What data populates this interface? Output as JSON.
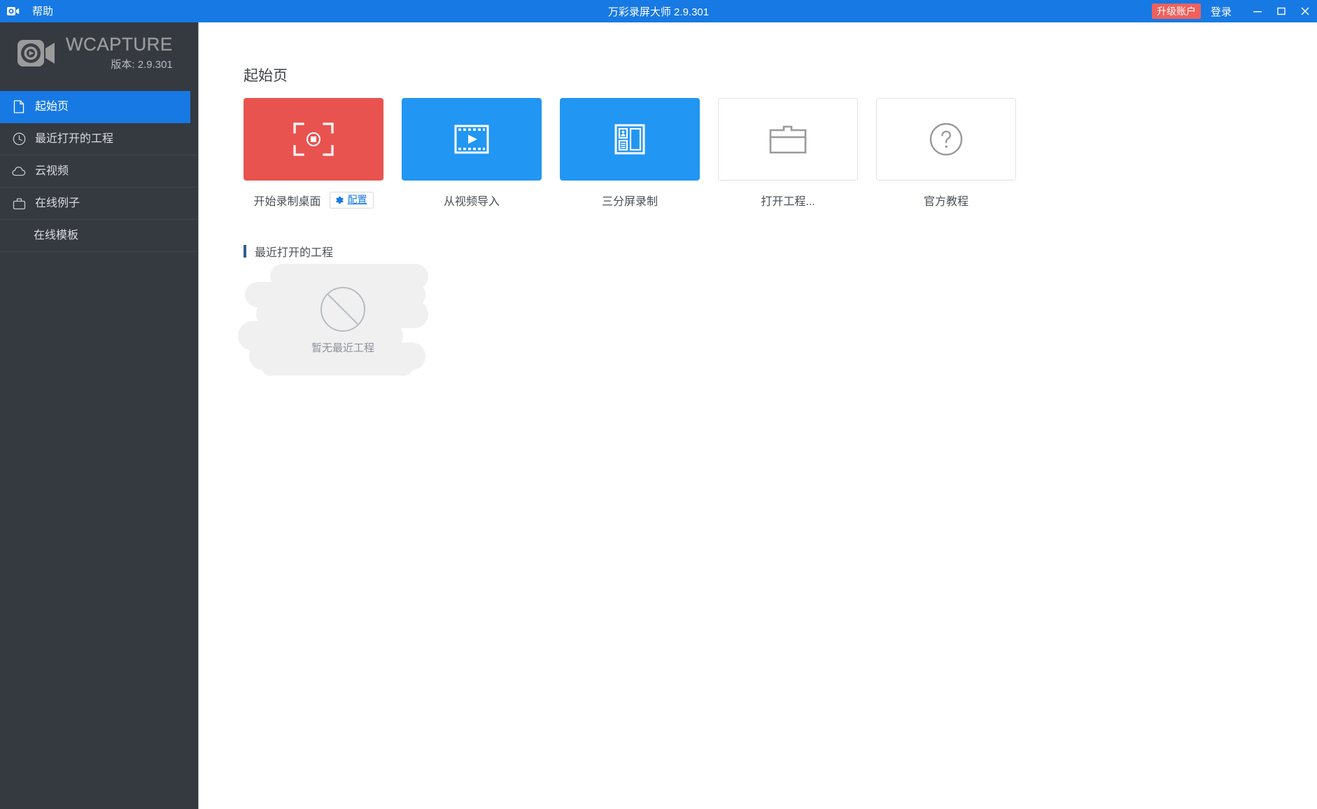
{
  "titlebar": {
    "app_icon": "video-camera-icon",
    "menu_help": "帮助",
    "window_title": "万彩录屏大师 2.9.301",
    "upgrade_label": "升级账户",
    "login_label": "登录",
    "minimize_icon": "minimize-icon",
    "maximize_icon": "maximize-icon",
    "close_icon": "close-icon",
    "bg_color": "#1779e3",
    "upgrade_color": "#f0605c"
  },
  "sidebar": {
    "brand_name": "WCAPTURE",
    "brand_version": "版本: 2.9.301",
    "brand_icon": "video-camera-logo-icon",
    "bg_color": "#353a41",
    "active_color": "#1779e3",
    "items": [
      {
        "label": "起始页",
        "icon": "document-icon",
        "active": true,
        "sub": false
      },
      {
        "label": "最近打开的工程",
        "icon": "clock-icon",
        "active": false,
        "sub": false
      },
      {
        "label": "云视频",
        "icon": "cloud-icon",
        "active": false,
        "sub": false
      },
      {
        "label": "在线例子",
        "icon": "briefcase-icon",
        "active": false,
        "sub": false
      },
      {
        "label": "在线模板",
        "icon": "",
        "active": false,
        "sub": true
      }
    ]
  },
  "main": {
    "page_title": "起始页",
    "cards": [
      {
        "label": "开始录制桌面",
        "icon": "record-target-icon",
        "style": "red",
        "has_config": true
      },
      {
        "label": "从视频导入",
        "icon": "film-play-icon",
        "style": "blue",
        "has_config": false
      },
      {
        "label": "三分屏录制",
        "icon": "split-screen-icon",
        "style": "blue",
        "has_config": false
      },
      {
        "label": "打开工程...",
        "icon": "folder-icon",
        "style": "plain",
        "has_config": false
      },
      {
        "label": "官方教程",
        "icon": "question-circle-icon",
        "style": "plain",
        "has_config": false
      }
    ],
    "config_button": {
      "label": "配置",
      "icon": "gear-icon",
      "color": "#1779e3"
    },
    "recent_section": {
      "title": "最近打开的工程",
      "accent_color": "#2b5f8f",
      "empty_text": "暂无最近工程",
      "empty_icon": "no-data-slash-circle-icon"
    }
  }
}
